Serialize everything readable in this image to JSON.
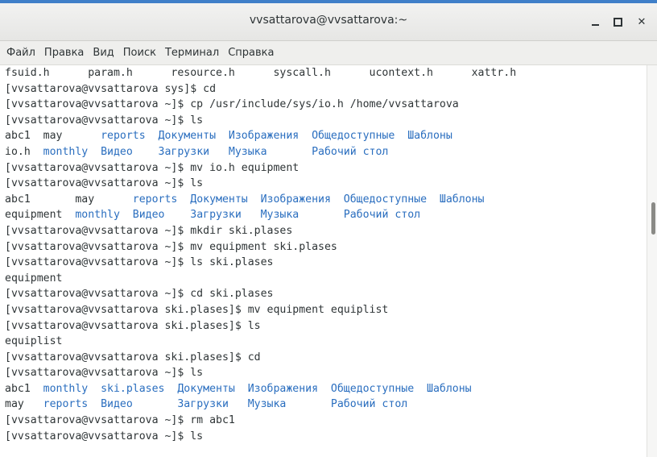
{
  "window": {
    "title": "vvsattarova@vvsattarova:~"
  },
  "menu": [
    "Файл",
    "Правка",
    "Вид",
    "Поиск",
    "Терминал",
    "Справка"
  ],
  "colors": {
    "accent": "#3f7fc9",
    "directory": "#2a6ebf",
    "text": "#2e3436"
  },
  "icons": {
    "minimize": "minimize-icon",
    "maximize": "maximize-icon",
    "close": "close-icon"
  },
  "terminal": {
    "lines": [
      [
        {
          "t": "fsuid.h      param.h      resource.h      syscall.h      ucontext.h      xattr.h",
          "c": "file"
        }
      ],
      [
        {
          "t": "[vvsattarova@vvsattarova sys]$ cd",
          "c": "file"
        }
      ],
      [
        {
          "t": "[vvsattarova@vvsattarova ~]$ cp /usr/include/sys/io.h /home/vvsattarova",
          "c": "file"
        }
      ],
      [
        {
          "t": "[vvsattarova@vvsattarova ~]$ ls",
          "c": "file"
        }
      ],
      [
        {
          "t": "abc1  may      ",
          "c": "file"
        },
        {
          "t": "reports  Документы  Изображения  Общедоступные  Шаблоны",
          "c": "dir"
        }
      ],
      [
        {
          "t": "io.h  ",
          "c": "file"
        },
        {
          "t": "monthly  Видео    Загрузки   Музыка       Рабочий стол",
          "c": "dir"
        }
      ],
      [
        {
          "t": "[vvsattarova@vvsattarova ~]$ mv io.h equipment",
          "c": "file"
        }
      ],
      [
        {
          "t": "[vvsattarova@vvsattarova ~]$ ls",
          "c": "file"
        }
      ],
      [
        {
          "t": "abc1       may      ",
          "c": "file"
        },
        {
          "t": "reports  Документы  Изображения  Общедоступные  Шаблоны",
          "c": "dir"
        }
      ],
      [
        {
          "t": "equipment  ",
          "c": "file"
        },
        {
          "t": "monthly  Видео    Загрузки   Музыка       Рабочий стол",
          "c": "dir"
        }
      ],
      [
        {
          "t": "[vvsattarova@vvsattarova ~]$ mkdir ski.plases",
          "c": "file"
        }
      ],
      [
        {
          "t": "[vvsattarova@vvsattarova ~]$ mv equipment ski.plases",
          "c": "file"
        }
      ],
      [
        {
          "t": "[vvsattarova@vvsattarova ~]$ ls ski.plases",
          "c": "file"
        }
      ],
      [
        {
          "t": "equipment",
          "c": "file"
        }
      ],
      [
        {
          "t": "[vvsattarova@vvsattarova ~]$ cd ski.plases",
          "c": "file"
        }
      ],
      [
        {
          "t": "[vvsattarova@vvsattarova ski.plases]$ mv equipment equiplist",
          "c": "file"
        }
      ],
      [
        {
          "t": "[vvsattarova@vvsattarova ski.plases]$ ls",
          "c": "file"
        }
      ],
      [
        {
          "t": "equiplist",
          "c": "file"
        }
      ],
      [
        {
          "t": "[vvsattarova@vvsattarova ski.plases]$ cd",
          "c": "file"
        }
      ],
      [
        {
          "t": "[vvsattarova@vvsattarova ~]$ ls",
          "c": "file"
        }
      ],
      [
        {
          "t": "abc1  ",
          "c": "file"
        },
        {
          "t": "monthly  ski.plases  Документы  Изображения  Общедоступные  Шаблоны",
          "c": "dir"
        }
      ],
      [
        {
          "t": "may   ",
          "c": "file"
        },
        {
          "t": "reports  Видео       Загрузки   Музыка       Рабочий стол",
          "c": "dir"
        }
      ],
      [
        {
          "t": "[vvsattarova@vvsattarova ~]$ rm abc1",
          "c": "file"
        }
      ],
      [
        {
          "t": "[vvsattarova@vvsattarova ~]$ ls",
          "c": "file"
        }
      ]
    ]
  }
}
